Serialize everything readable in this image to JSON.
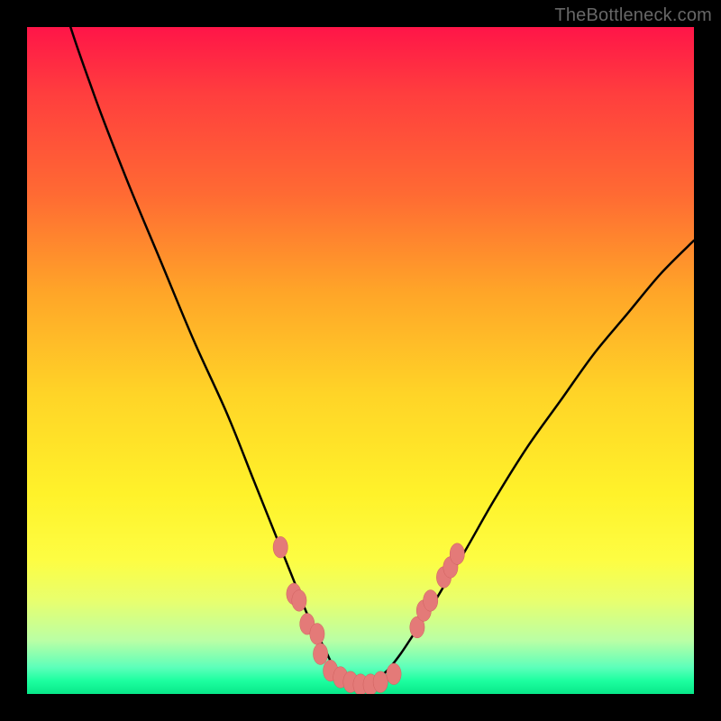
{
  "attribution": "TheBottleneck.com",
  "colors": {
    "page_bg": "#000000",
    "curve": "#000000",
    "marker_fill": "#e47a78",
    "marker_stroke": "#cf605e",
    "gradient_top": "#ff1548",
    "gradient_bottom": "#08e889"
  },
  "chart_data": {
    "type": "line",
    "title": "",
    "xlabel": "",
    "ylabel": "",
    "xlim": [
      0,
      100
    ],
    "ylim": [
      0,
      100
    ],
    "grid": false,
    "legend": false,
    "annotations": [],
    "series": [
      {
        "name": "bottleneck-curve",
        "x": [
          0,
          5,
          10,
          15,
          20,
          25,
          30,
          34,
          38,
          40,
          42,
          44,
          45,
          46,
          47,
          48,
          49,
          50,
          51,
          52,
          54,
          56,
          58,
          60,
          63,
          66,
          70,
          75,
          80,
          85,
          90,
          95,
          100
        ],
        "y": [
          125,
          105,
          90,
          77,
          65,
          53,
          42,
          32,
          22,
          17,
          12,
          8,
          6,
          4,
          3,
          2,
          1.5,
          1.2,
          1.5,
          2,
          3.5,
          6,
          9,
          12,
          17,
          22,
          29,
          37,
          44,
          51,
          57,
          63,
          68
        ]
      }
    ],
    "markers": {
      "rx": 1.1,
      "ry": 1.6,
      "points": [
        {
          "x": 38.0,
          "y": 22.0
        },
        {
          "x": 40.0,
          "y": 15.0
        },
        {
          "x": 40.8,
          "y": 14.0
        },
        {
          "x": 42.0,
          "y": 10.5
        },
        {
          "x": 43.5,
          "y": 9.0
        },
        {
          "x": 44.0,
          "y": 6.0
        },
        {
          "x": 45.5,
          "y": 3.5
        },
        {
          "x": 47.0,
          "y": 2.5
        },
        {
          "x": 48.5,
          "y": 1.8
        },
        {
          "x": 50.0,
          "y": 1.4
        },
        {
          "x": 51.5,
          "y": 1.4
        },
        {
          "x": 53.0,
          "y": 1.8
        },
        {
          "x": 55.0,
          "y": 3.0
        },
        {
          "x": 58.5,
          "y": 10.0
        },
        {
          "x": 59.5,
          "y": 12.5
        },
        {
          "x": 60.5,
          "y": 14.0
        },
        {
          "x": 62.5,
          "y": 17.5
        },
        {
          "x": 63.5,
          "y": 19.0
        },
        {
          "x": 64.5,
          "y": 21.0
        }
      ]
    }
  }
}
